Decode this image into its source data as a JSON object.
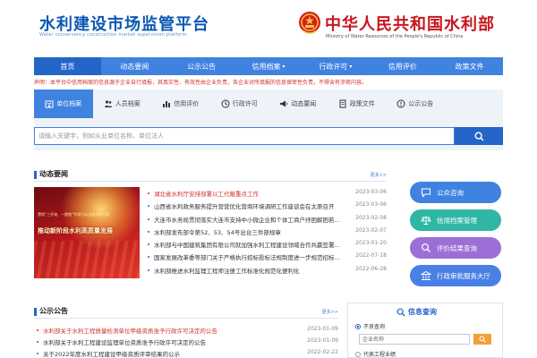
{
  "header": {
    "site_title": "水利建设市场监管平台",
    "site_subtitle": "Water conservancy construction market supervision platform",
    "ministry_title": "中华人民共和国水利部",
    "ministry_subtitle": "Ministry of Water Resources of the People's Republic of China"
  },
  "nav": {
    "items": [
      {
        "label": "首页",
        "caret": false
      },
      {
        "label": "动态要闻",
        "caret": false
      },
      {
        "label": "公示公告",
        "caret": false
      },
      {
        "label": "信用档案",
        "caret": true
      },
      {
        "label": "行政许可",
        "caret": true
      },
      {
        "label": "信用评价",
        "caret": false
      },
      {
        "label": "政策文件",
        "caret": false
      }
    ]
  },
  "notice": "声明：本平台中信用档案的信息源于企业自行填报，其真实性、有效性由企业负责，各企业对所填报的信息保密性负责，不得含有涉密内容。",
  "search": {
    "tabs": [
      {
        "label": "单位档案",
        "icon": "building-icon"
      },
      {
        "label": "人员档案",
        "icon": "people-icon"
      },
      {
        "label": "信用评价",
        "icon": "bar-chart-icon"
      },
      {
        "label": "行政许可",
        "icon": "stamp-icon"
      },
      {
        "label": "动态要闻",
        "icon": "megaphone-icon"
      },
      {
        "label": "政策文件",
        "icon": "document-icon"
      },
      {
        "label": "公示公告",
        "icon": "notice-icon"
      }
    ],
    "placeholder": "请输入关键字，例如从业单位名称、单位法人"
  },
  "news": {
    "title": "动态要闻",
    "more": "更多>>",
    "banner_line1": "贯彻“三开始、一提效”专项行动全面实施方案",
    "banner_line2": "推动新阶段水利高质量发展",
    "items": [
      {
        "title": "湖北省水利厅安排部署以工代赈重点工作",
        "date": "2023-03-06"
      },
      {
        "title": "山西省水利政务服务提升营营优化营商环境调研工作座谈会在太原召开",
        "date": "2023-03-06"
      },
      {
        "title": "大连市水务局贯彻落实大连市支持中小微企业和个体工商户纾困解困若干措施",
        "date": "2023-02-08"
      },
      {
        "title": "水利部发布部令第52、53、54号出台三件部规章",
        "date": "2023-02-07"
      },
      {
        "title": "水利部与中国建筑集团有限公司就加强水利工程建设领域合作共赢签署协议",
        "date": "2023-01-20"
      },
      {
        "title": "国家发展改革委等部门关于严格执行招标投标法规制度进一步规范招标投标主体行为",
        "date": "2022-07-18"
      },
      {
        "title": "水利部推进水利监理工程师注册工作标准化规范化便利化",
        "date": "2022-06-28"
      }
    ]
  },
  "announcements": {
    "title": "公示公告",
    "more": "更多>>",
    "items": [
      {
        "title": "水利部关于水利工程质量检测单位甲级资质准予行政许可决定的公告",
        "date": "2023-01-09"
      },
      {
        "title": "水利部关于水利工程建设监理单位资质准予行政许可决定的公告",
        "date": "2023-01-09"
      },
      {
        "title": "关于2022年度水利工程建设甲级资质评审结果的公示",
        "date": "2022-02-22"
      }
    ]
  },
  "side_buttons": [
    {
      "label": "公众咨询",
      "icon": "chat-icon",
      "color": "#3f82e0"
    },
    {
      "label": "信用档案管理",
      "icon": "balance-icon",
      "color": "#2fb7a5"
    },
    {
      "label": "评价结果查询",
      "icon": "search-icon",
      "color": "#9b6fd6"
    },
    {
      "label": "行政审批服务大厅",
      "icon": "hall-icon",
      "color": "#4a7fe6"
    }
  ],
  "info_query": {
    "title": "信息查询",
    "option1": "不良查询",
    "input_placeholder": "企业名称",
    "option2": "代表工程业绩"
  },
  "colors": {
    "brand_blue": "#2466c8",
    "nav_blue": "#3f82e0",
    "ministry_red": "#c8161d",
    "alert_red": "#d0312d"
  }
}
